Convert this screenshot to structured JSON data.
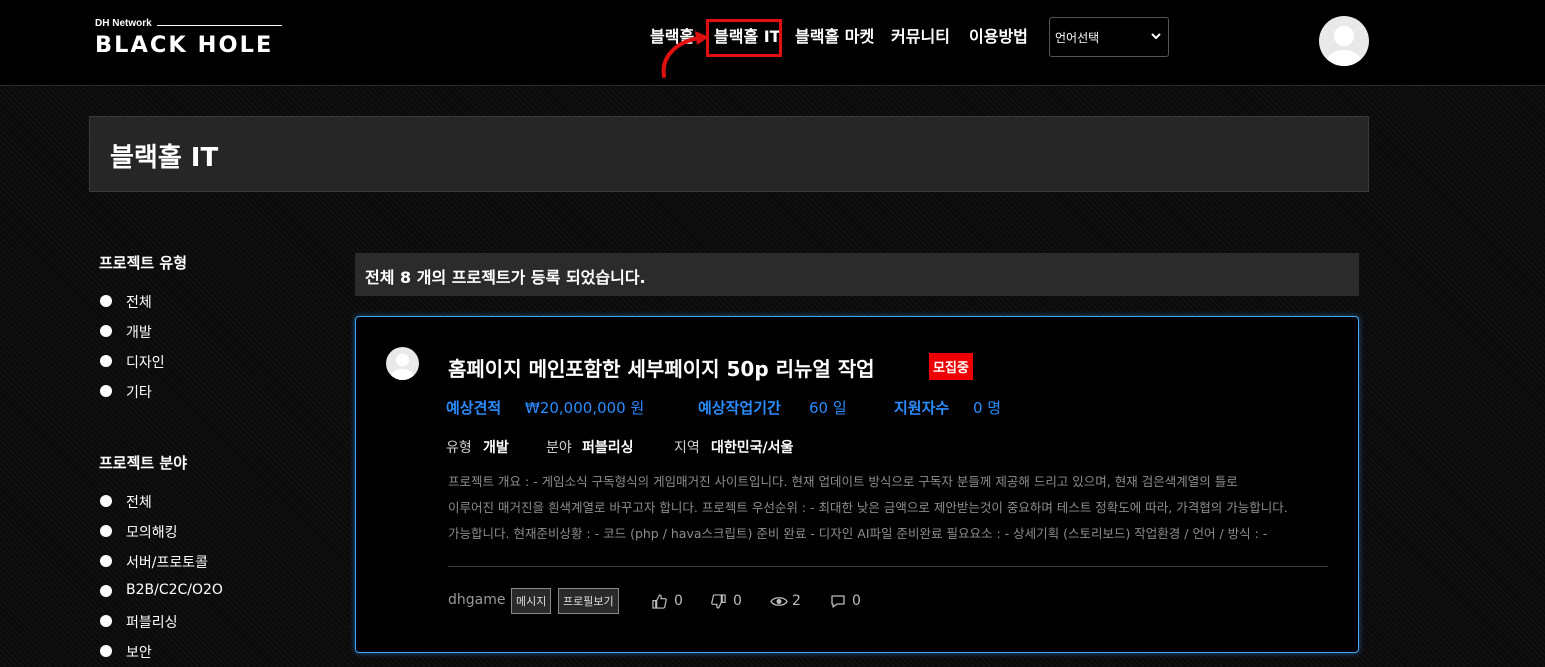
{
  "header": {
    "logo": {
      "network": "DH Network",
      "brand": "BLACK HOLE"
    },
    "nav": [
      {
        "label": "블랙홀"
      },
      {
        "label": "블랙홀 IT"
      },
      {
        "label": "블랙홀 마켓"
      },
      {
        "label": "커뮤니티"
      },
      {
        "label": "이용방법"
      }
    ],
    "language_select": {
      "value": "언어선택"
    },
    "icons": {
      "avatar": "user-avatar-icon",
      "chevron": "chevron-down-icon"
    },
    "highlight_color": "#e01010"
  },
  "page": {
    "title": "블랙홀 IT"
  },
  "sidebar": {
    "project_type": {
      "title": "프로젝트 유형",
      "options": [
        "전체",
        "개발",
        "디자인",
        "기타"
      ]
    },
    "project_field": {
      "title": "프로젝트 분야",
      "options": [
        "전체",
        "모의해킹",
        "서버/프로토콜",
        "B2B/C2C/O2O",
        "퍼블리싱",
        "보안"
      ]
    }
  },
  "main": {
    "count": {
      "prefix": "전체",
      "number": "8",
      "suffix": "개의 프로젝트가 등록 되었습니다."
    },
    "projects": [
      {
        "title": "홈페이지 메인포함한 세부페이지 50p 리뉴얼 작업",
        "status": "모집중",
        "estimate_label": "예상견적",
        "estimate_value": "₩20,000,000 원",
        "period_label": "예상작업기간",
        "period_value": "60 일",
        "applicants_label": "지원자수",
        "applicants_value": "0 명",
        "type_label": "유형",
        "type_value": "개발",
        "field_label": "분야",
        "field_value": "퍼블리싱",
        "region_label": "지역",
        "region_value": "대한민국/서울",
        "description": [
          "프로젝트 개요 : - 게임소식 구독형식의 게임매거진 사이트입니다. 현재 업데이트 방식으로 구독자 분들께 제공해 드리고 있으며, 현재 검은색계열의 틀로",
          "이루어진 매거진을 흰색계열로 바꾸고자 합니다. 프로젝트 우선순위 : - 최대한 낮은 금액으로 제안받는것이 중요하며 테스트 정확도에 따라, 가격협의 가능합니다.",
          "가능합니다. 현재준비상황 : - 코드 (php / hava스크립트) 준비 완료 - 디자인 AI파일 준비완료 필요요소 : - 상세기획 (스토리보드) 작업환경 / 언어 / 방식 : -"
        ],
        "author": "dhgame",
        "message_label": "메시지",
        "profile_label": "프로필보기",
        "likes": "0",
        "dislikes": "0",
        "views": "2",
        "comments": "0",
        "status_color": "#ee0000",
        "accent_color": "#2a8cff"
      }
    ]
  }
}
